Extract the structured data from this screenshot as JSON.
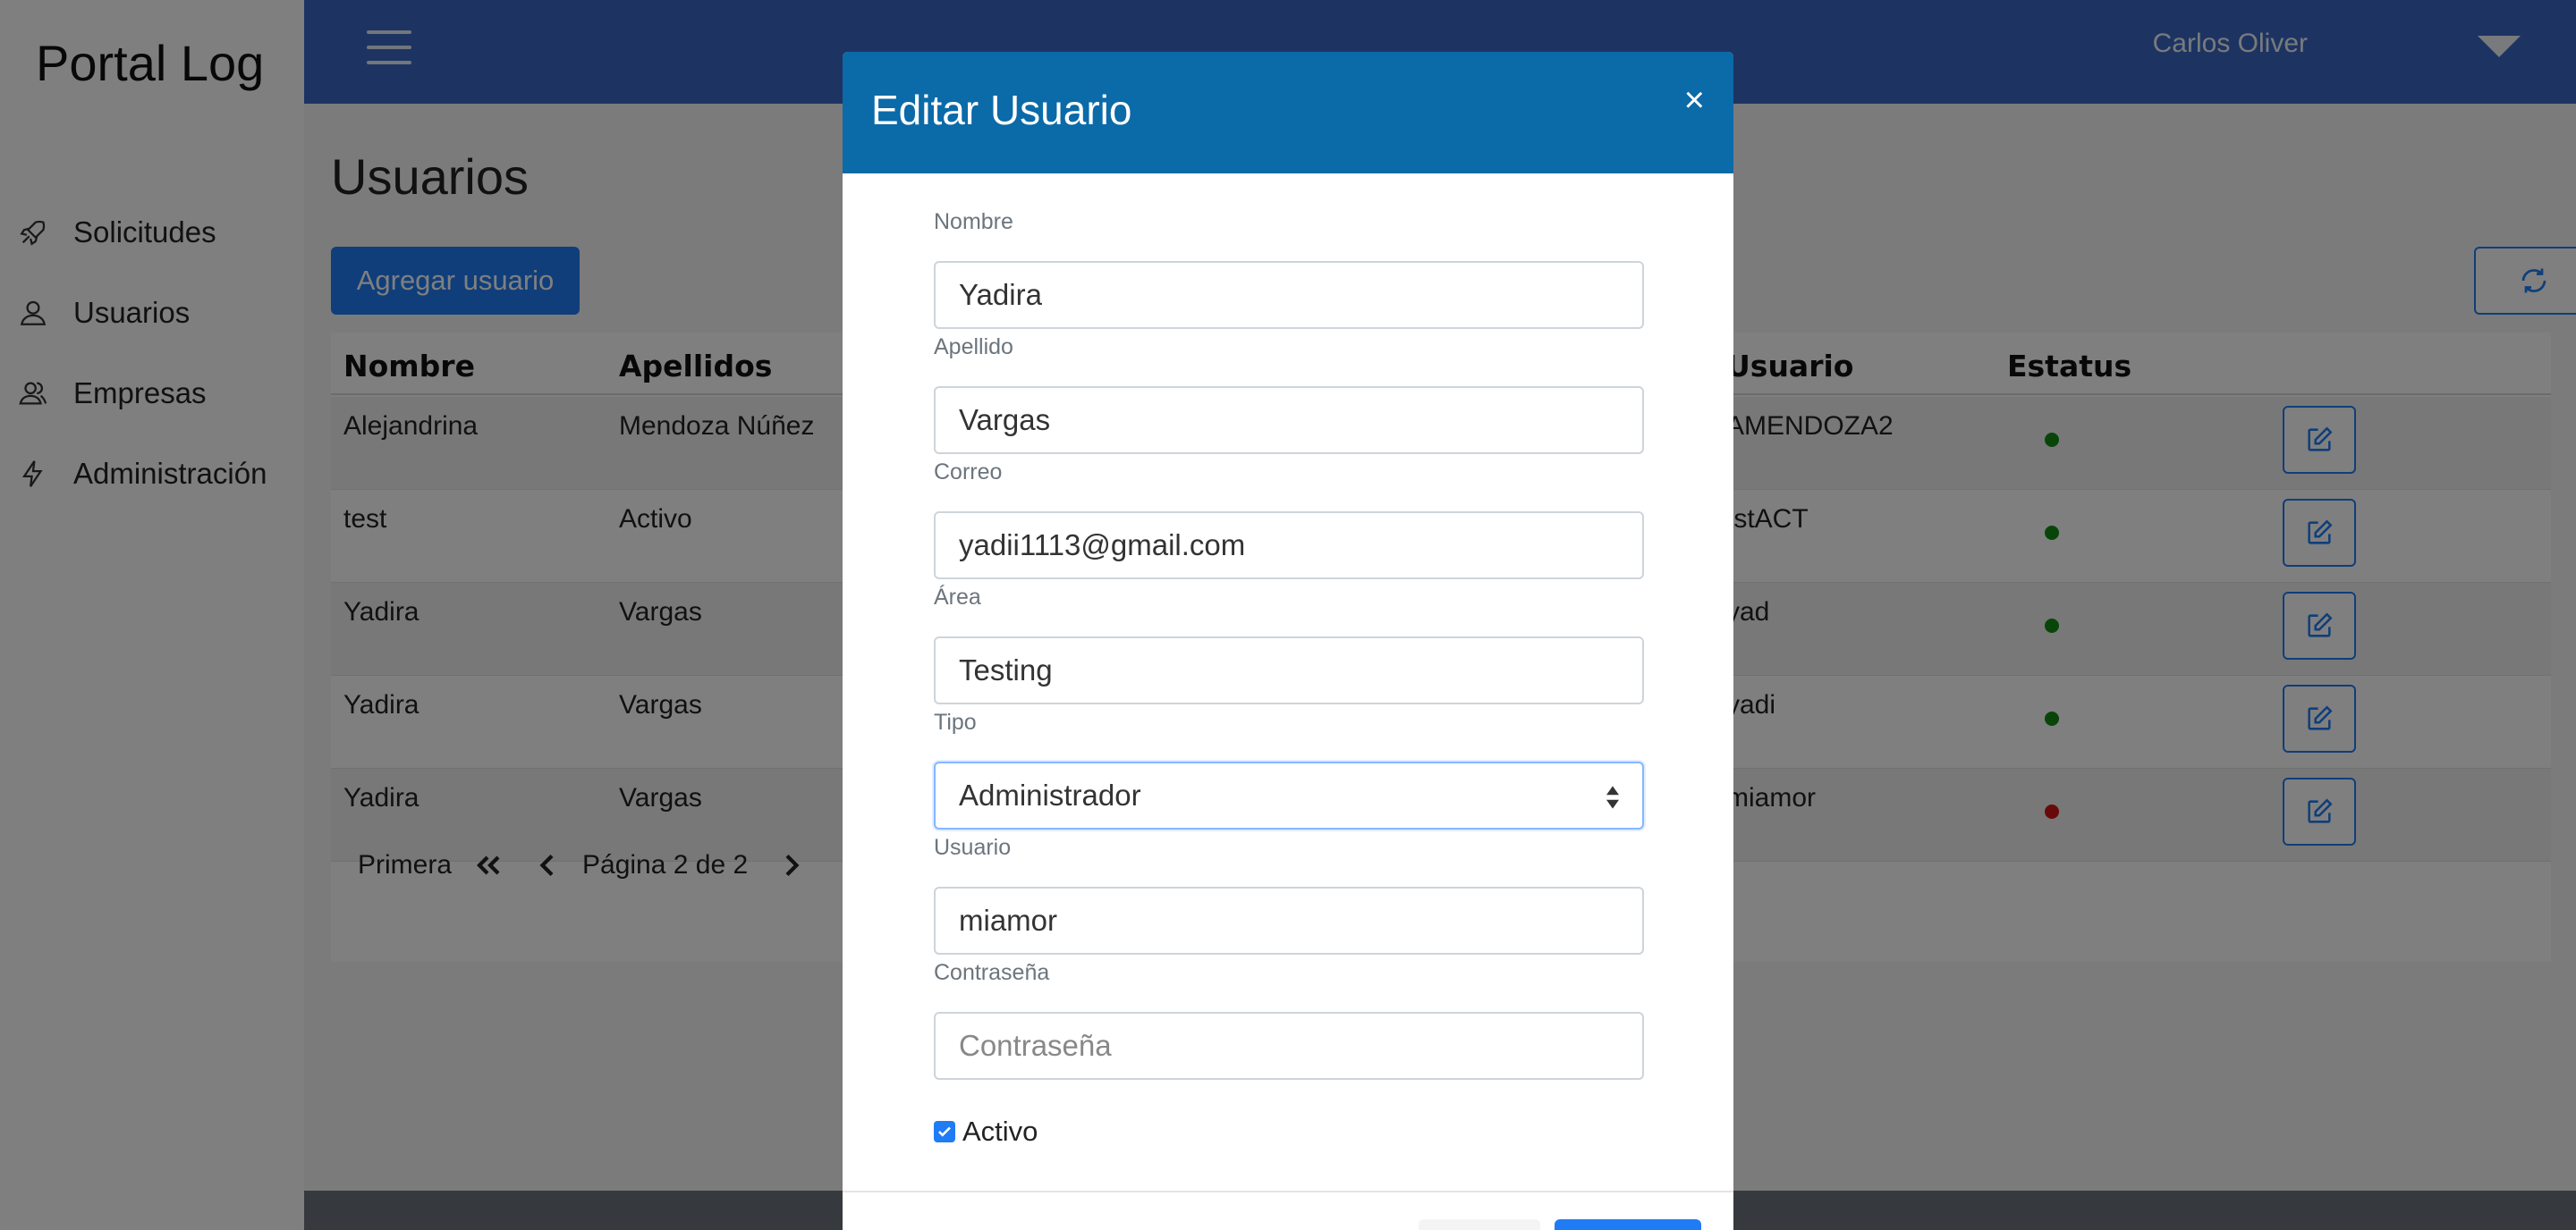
{
  "app": {
    "brand": "Portal Log"
  },
  "sidebar": {
    "items": [
      {
        "label": "Solicitudes",
        "icon": "rocket-icon"
      },
      {
        "label": "Usuarios",
        "icon": "user-icon"
      },
      {
        "label": "Empresas",
        "icon": "users-icon"
      },
      {
        "label": "Administración",
        "icon": "bolt-icon"
      }
    ]
  },
  "topbar": {
    "user_name": "Carlos Oliver"
  },
  "page": {
    "title": "Usuarios",
    "add_button": "Agregar usuario"
  },
  "table": {
    "headers": [
      "Nombre",
      "Apellidos",
      "Usuario",
      "Estatus"
    ],
    "rows": [
      {
        "nombre": "Alejandrina",
        "apellidos": "Mendoza Núñez",
        "usuario": "AMENDOZA2",
        "status": "active"
      },
      {
        "nombre": "test",
        "apellidos": "Activo",
        "usuario": "tstACT",
        "status": "active"
      },
      {
        "nombre": "Yadira",
        "apellidos": "Vargas",
        "usuario": "yad",
        "status": "active"
      },
      {
        "nombre": "Yadira",
        "apellidos": "Vargas",
        "usuario": "yadi",
        "status": "active"
      },
      {
        "nombre": "Yadira",
        "apellidos": "Vargas",
        "usuario": "miamor",
        "status": "inactive"
      }
    ],
    "status_colors": {
      "active": "#138a13",
      "inactive": "#d01515"
    }
  },
  "pager": {
    "first": "Primera",
    "page_text": "Página 2 de 2"
  },
  "modal": {
    "title": "Editar Usuario",
    "close": "×",
    "fields": {
      "nombre": {
        "label": "Nombre",
        "value": "Yadira"
      },
      "apellido": {
        "label": "Apellido",
        "value": "Vargas"
      },
      "correo": {
        "label": "Correo",
        "value": "yadii1113@gmail.com"
      },
      "area": {
        "label": "Área",
        "value": "Testing"
      },
      "tipo": {
        "label": "Tipo",
        "value": "Administrador"
      },
      "usuario": {
        "label": "Usuario",
        "value": "miamor"
      },
      "contrasena": {
        "label": "Contraseña",
        "placeholder": "Contraseña"
      }
    },
    "activo_label": "Activo",
    "activo_checked": true
  },
  "colors": {
    "accent": "#1f7cf5",
    "topbar": "#3a68c4",
    "modal_header": "#0b6aa8"
  }
}
